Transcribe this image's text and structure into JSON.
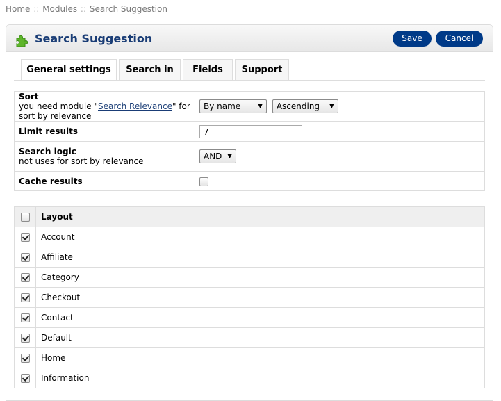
{
  "breadcrumb": {
    "home": "Home",
    "modules": "Modules",
    "current": "Search Suggestion",
    "separator": "::"
  },
  "heading": {
    "title": "Search Suggestion",
    "icon": "puzzle-icon",
    "save_label": "Save",
    "cancel_label": "Cancel"
  },
  "tabs": [
    {
      "label": "General settings",
      "active": true
    },
    {
      "label": "Search in"
    },
    {
      "label": "Fields"
    },
    {
      "label": "Support"
    }
  ],
  "form": {
    "sort": {
      "label": "Sort",
      "help_prefix": "you need module \"",
      "help_link": "Search Relevance",
      "help_suffix": "\" for sort by relevance",
      "by_value": "By name",
      "order_value": "Ascending"
    },
    "limit": {
      "label": "Limit results",
      "value": "7"
    },
    "logic": {
      "label": "Search logic",
      "help": "not uses for sort by relevance",
      "value": "AND"
    },
    "cache": {
      "label": "Cache results",
      "checked": false
    }
  },
  "layouts": {
    "header": "Layout",
    "items": [
      {
        "name": "Account",
        "checked": true
      },
      {
        "name": "Affiliate",
        "checked": true
      },
      {
        "name": "Category",
        "checked": true
      },
      {
        "name": "Checkout",
        "checked": true
      },
      {
        "name": "Contact",
        "checked": true
      },
      {
        "name": "Default",
        "checked": true
      },
      {
        "name": "Home",
        "checked": true
      },
      {
        "name": "Information",
        "checked": true
      }
    ]
  },
  "colors": {
    "accent": "#003a88",
    "title": "#1a3d76",
    "border": "#dddddd"
  }
}
